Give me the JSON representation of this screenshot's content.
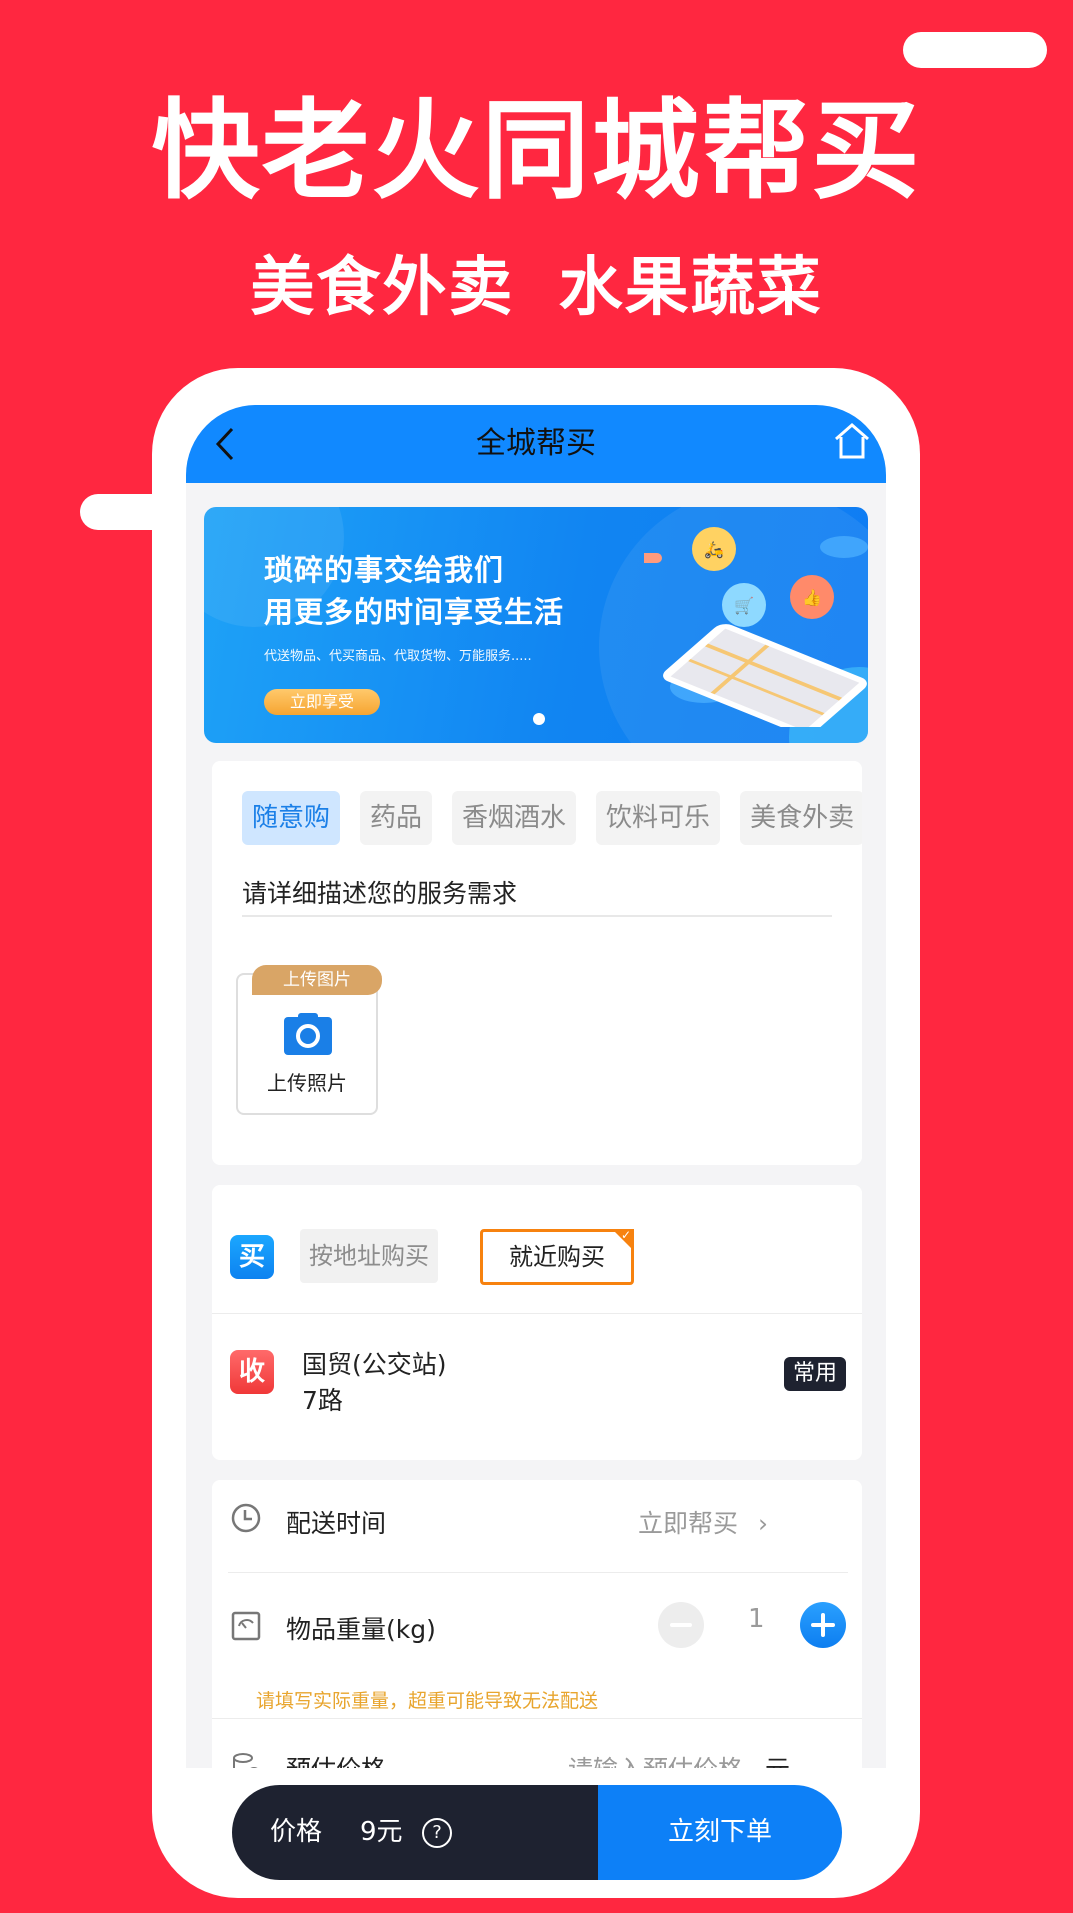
{
  "hero": {
    "title": "快老火同城帮买",
    "subtitle": "美食外卖  水果蔬菜"
  },
  "navbar": {
    "title": "全城帮买",
    "back_icon": "chevron-left-icon",
    "home_icon": "home-icon"
  },
  "banner": {
    "line1": "琐碎的事交给我们",
    "line2": "用更多的时间享受生活",
    "description": "代送物品、代买商品、代取货物、万能服务.....",
    "cta": "立即享受",
    "page_indicator": "1"
  },
  "service": {
    "tabs": [
      {
        "label": "随意购",
        "active": true
      },
      {
        "label": "药品",
        "active": false
      },
      {
        "label": "香烟酒水",
        "active": false
      },
      {
        "label": "饮料可乐",
        "active": false
      },
      {
        "label": "美食外卖",
        "active": false
      }
    ],
    "description_placeholder": "请详细描述您的服务需求",
    "upload_badge": "上传图片",
    "upload_label": "上传照片"
  },
  "address": {
    "buy_icon_label": "买",
    "options": [
      {
        "label": "按地址购买",
        "selected": false
      },
      {
        "label": "就近购买",
        "selected": true
      }
    ],
    "receive_icon_label": "收",
    "line1": "国贸(公交站)",
    "line2": "7路",
    "tag": "常用"
  },
  "options": {
    "delivery_time_label": "配送时间",
    "delivery_time_value": "立即帮买",
    "weight_label": "物品重量(kg)",
    "weight_value": "1",
    "weight_hint": "请填写实际重量，超重可能导致无法配送",
    "estimate_label": "预估价格",
    "estimate_placeholder": "请输入预估价格",
    "estimate_unit": "元"
  },
  "bottom_bar": {
    "price_label": "价格",
    "price_value": "9元",
    "help_glyph": "?",
    "submit_label": "立刻下单"
  },
  "colors": {
    "background": "#ff2740",
    "primary_blue": "#1189ff",
    "accent_orange": "#f7820f",
    "hint_gold": "#e8a52e",
    "dark_bar": "#1e2230"
  }
}
